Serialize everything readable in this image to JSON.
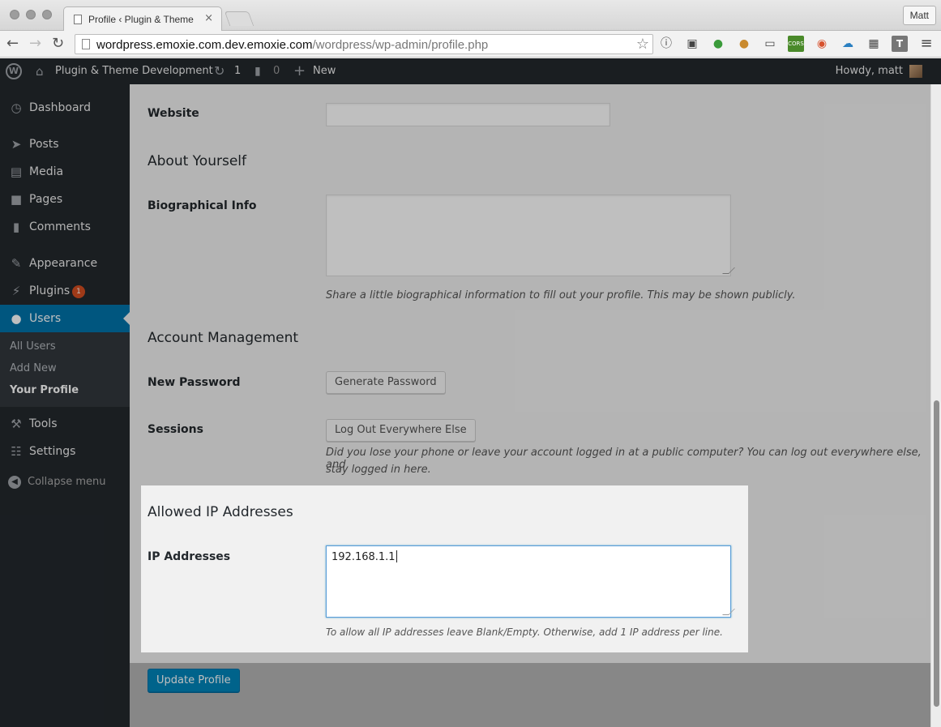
{
  "browser": {
    "tab_title": "Profile ‹ Plugin & Theme De",
    "tab_close": "×",
    "profile_name": "Matt",
    "url_host": "wordpress.emoxie.com.dev.emoxie.com",
    "url_path": "/wordpress/wp-admin/profile.php",
    "extensions": [
      "info-icon",
      "lock-icon",
      "evernote-icon",
      "cookie-icon",
      "cast-icon",
      "cors-icon",
      "color-icon",
      "cloud-icon",
      "film-icon",
      "t-icon",
      "menu-icon"
    ],
    "cors_label": "CORS",
    "t_label": "T"
  },
  "adminbar": {
    "site_name": "Plugin & Theme Development",
    "updates_count": "1",
    "comments_count": "0",
    "new_label": "New",
    "howdy": "Howdy, matt"
  },
  "sidebar": {
    "items": [
      {
        "label": "Dashboard",
        "icon": "dashboard-icon"
      },
      {
        "label": "Posts",
        "icon": "pin-icon"
      },
      {
        "label": "Media",
        "icon": "media-icon"
      },
      {
        "label": "Pages",
        "icon": "pages-icon"
      },
      {
        "label": "Comments",
        "icon": "comment-icon"
      },
      {
        "label": "Appearance",
        "icon": "brush-icon"
      },
      {
        "label": "Plugins",
        "icon": "plug-icon"
      },
      {
        "label": "Users",
        "icon": "user-icon"
      },
      {
        "label": "Tools",
        "icon": "wrench-icon"
      },
      {
        "label": "Settings",
        "icon": "sliders-icon"
      }
    ],
    "plugins_badge": "1",
    "submenu": [
      "All Users",
      "Add New",
      "Your Profile"
    ],
    "collapse_label": "Collapse menu"
  },
  "form": {
    "website_label": "Website",
    "website_value": "",
    "about_heading": "About Yourself",
    "bio_label": "Biographical Info",
    "bio_value": "",
    "bio_desc": "Share a little biographical information to fill out your profile. This may be shown publicly.",
    "account_heading": "Account Management",
    "password_label": "New Password",
    "generate_button": "Generate Password",
    "sessions_label": "Sessions",
    "logout_button": "Log Out Everywhere Else",
    "sessions_desc_line1": "Did you lose your phone or leave your account logged in at a public computer? You can log out everywhere else, and",
    "sessions_desc_line2": "stay logged in here.",
    "ip_heading": "Allowed IP Addresses",
    "ip_label": "IP Addresses",
    "ip_value": "192.168.1.1",
    "ip_desc": "To allow all IP addresses leave Blank/Empty. Otherwise, add 1 IP address per line.",
    "update_button": "Update Profile"
  }
}
